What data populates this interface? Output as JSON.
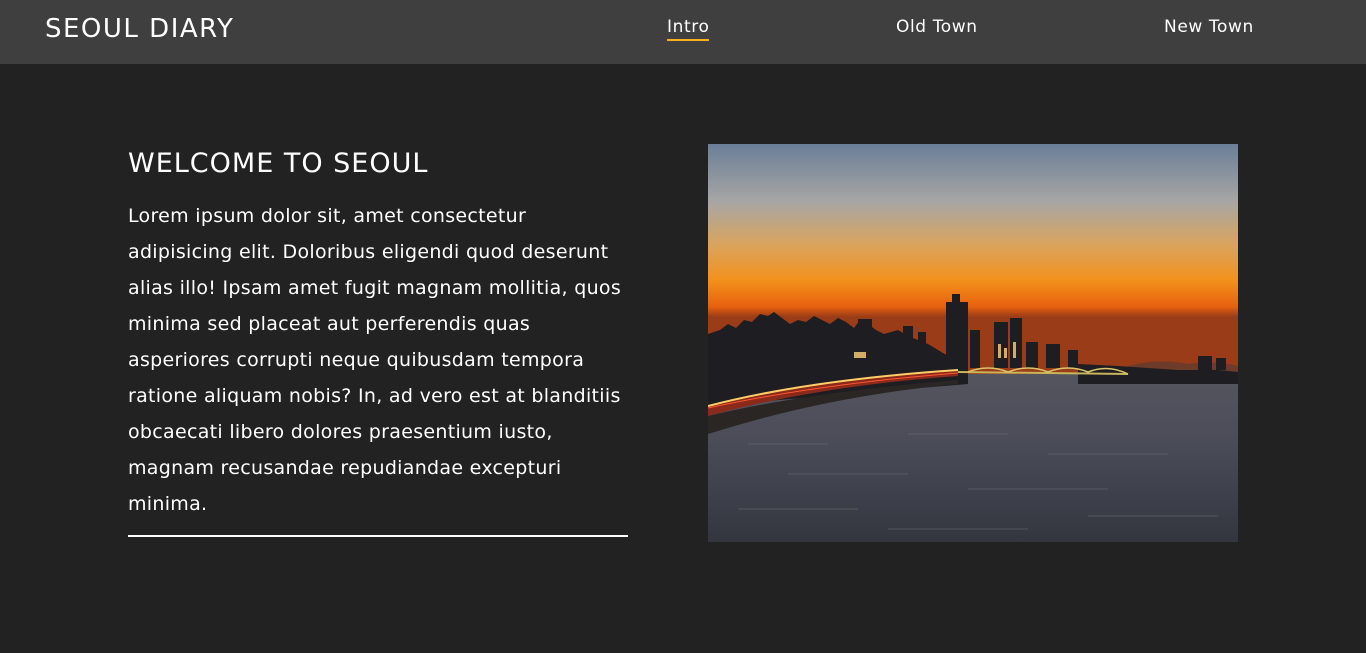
{
  "header": {
    "brand": "SEOUL DIARY",
    "nav": [
      {
        "label": "Intro",
        "active": true
      },
      {
        "label": "Old Town",
        "active": false
      },
      {
        "label": "New Town",
        "active": false
      }
    ],
    "active_underline_color": "#f5b21e"
  },
  "main": {
    "title": "WELCOME TO SEOUL",
    "body": "Lorem ipsum dolor sit, amet consectetur adipisicing elit. Doloribus eligendi quod deserunt alias illo! Ipsam amet fugit magnam mollitia, quos minima sed placeat aut perferendis quas asperiores corrupti neque quibusdam tempora ratione aliquam nobis? In, ad vero est at blanditiis obcaecati libero dolores praesentium iusto, magnam recusandae repudiandae excepturi minima.",
    "image": {
      "subject": "seoul-skyline-sunset-over-river"
    }
  },
  "colors": {
    "background": "#222222",
    "header": "#3f3f3f",
    "text": "#ffffff"
  }
}
